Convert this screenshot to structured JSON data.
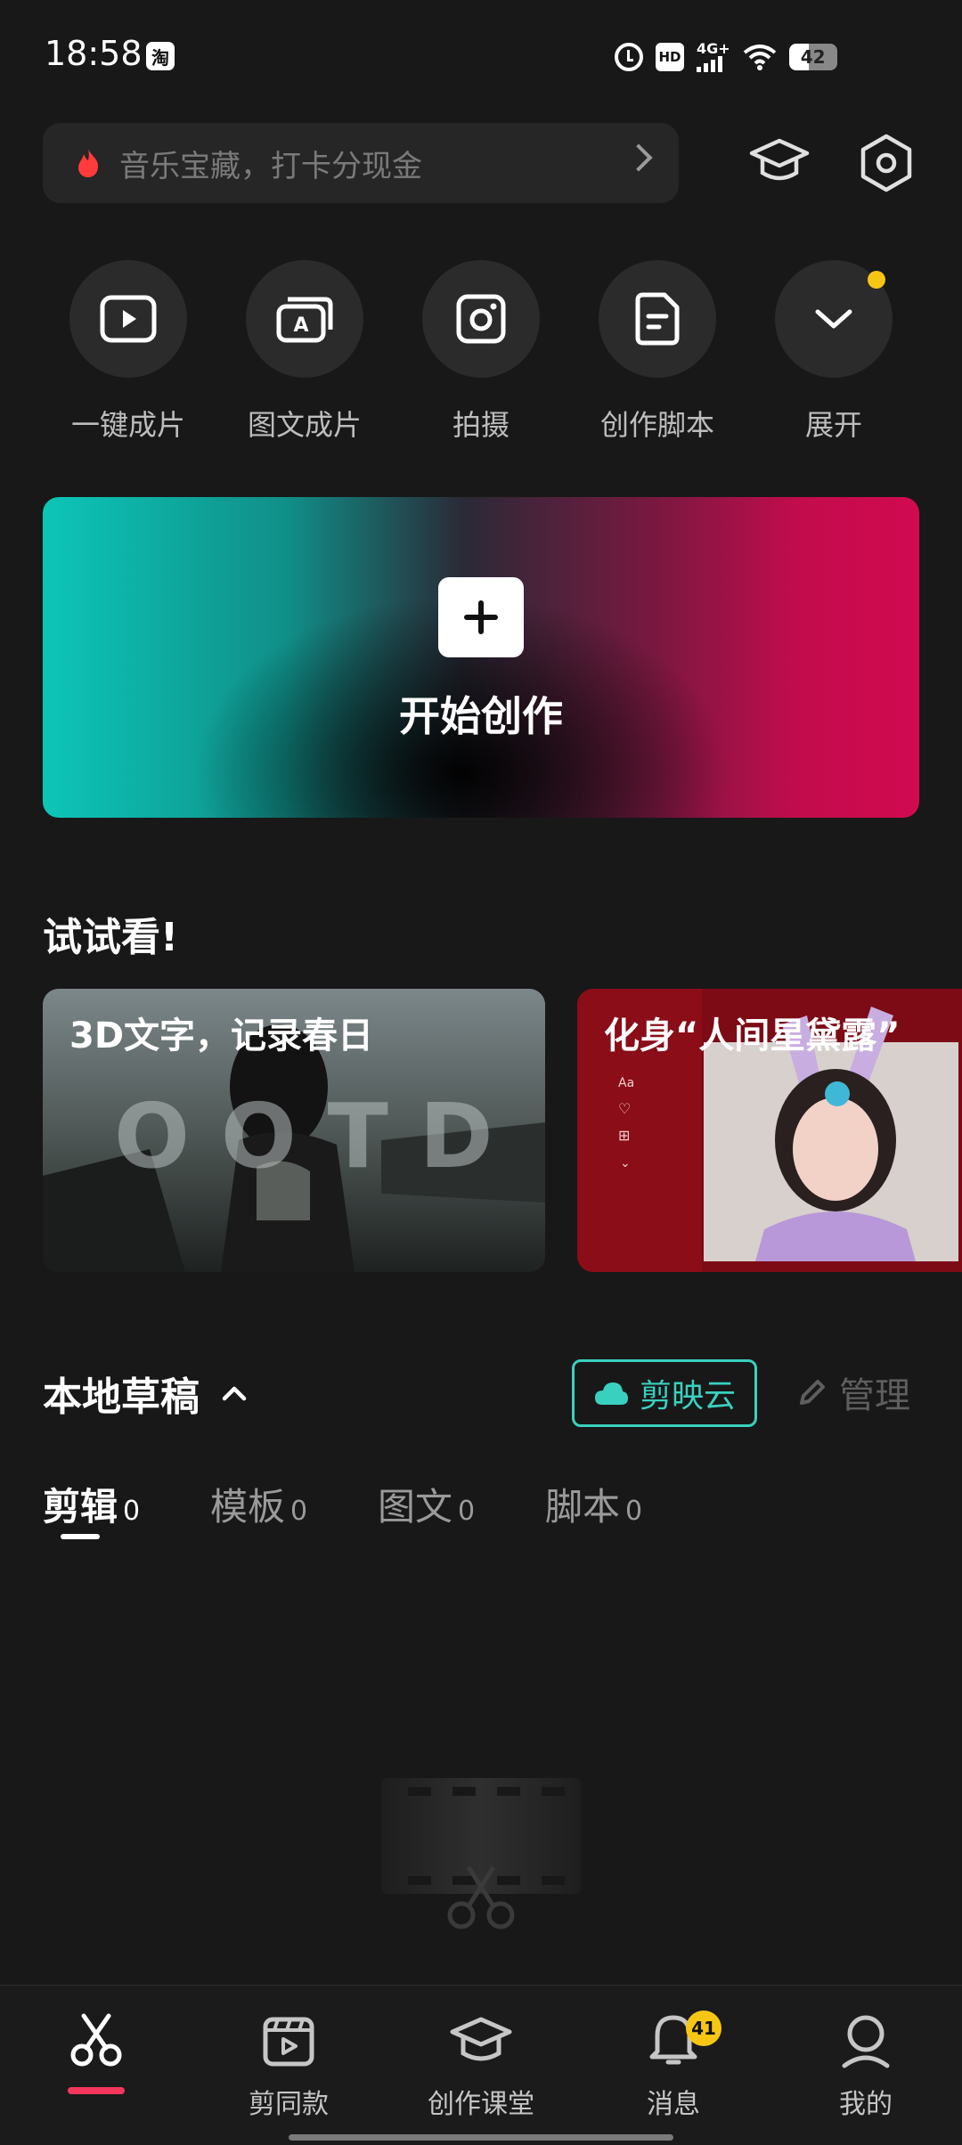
{
  "status_bar": {
    "time": "18:58",
    "app_badge": "淘",
    "hd": "HD",
    "network": "4G+",
    "battery": "42",
    "battery_level_percent": 42
  },
  "search": {
    "placeholder": "音乐宝藏，打卡分现金"
  },
  "quick_actions": [
    {
      "label": "一键成片",
      "icon": "play-box-icon"
    },
    {
      "label": "图文成片",
      "icon": "image-text-icon"
    },
    {
      "label": "拍摄",
      "icon": "camera-icon"
    },
    {
      "label": "创作脚本",
      "icon": "script-doc-icon"
    },
    {
      "label": "展开",
      "icon": "chevron-down-icon"
    }
  ],
  "banner": {
    "label": "开始创作"
  },
  "try_section": {
    "title": "试试看!",
    "cards": [
      {
        "title": "3D文字，记录春日"
      },
      {
        "title": "化身“人间星黛露”"
      }
    ]
  },
  "drafts": {
    "title": "本地草稿",
    "cloud_label": "剪映云",
    "manage_label": "管理",
    "tabs": [
      {
        "label": "剪辑",
        "count": "0"
      },
      {
        "label": "模板",
        "count": "0"
      },
      {
        "label": "图文",
        "count": "0"
      },
      {
        "label": "脚本",
        "count": "0"
      }
    ]
  },
  "bottom_nav": {
    "items": [
      {
        "label": ""
      },
      {
        "label": "剪同款"
      },
      {
        "label": "创作课堂"
      },
      {
        "label": "消息",
        "badge": "41"
      },
      {
        "label": "我的"
      }
    ]
  },
  "colors": {
    "background": "#181818",
    "accent_teal": "#3ad0bf",
    "accent_red": "#f5365c",
    "badge_yellow": "#f6c615"
  }
}
